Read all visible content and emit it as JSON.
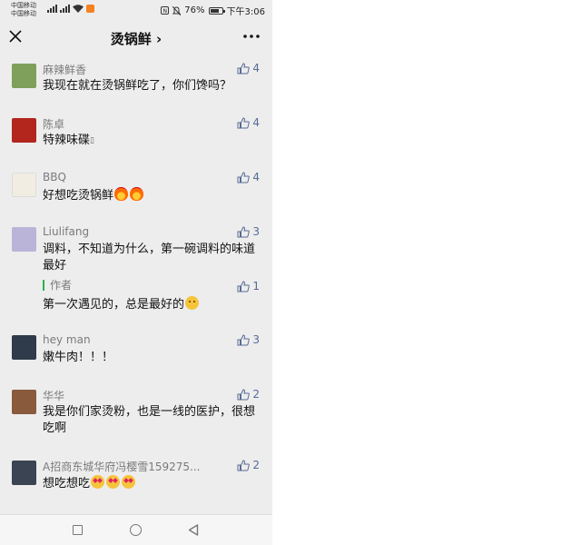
{
  "status_bar": {
    "carrier_1": "中国移动",
    "carrier_2": "中国移动",
    "battery_percent": "76%",
    "battery_level": 0.76,
    "time": "下午3:06"
  },
  "nav": {
    "title": "烫锅鲜 ›",
    "close_icon": "close-icon",
    "more_icon": "more-icon"
  },
  "comments": [
    {
      "name": "麻辣鲜香",
      "text": "我现在就在烫锅鲜吃了，你们馋吗？",
      "likes": "4",
      "avatar_color": "#7ea05a"
    },
    {
      "name": "陈卓",
      "text": "特辣味碟",
      "likes": "4",
      "avatar_color": "#b2261e"
    },
    {
      "name": "BBQ",
      "text": "好想吃烫锅鲜",
      "likes": "4",
      "avatar_color": "#f2ede3"
    },
    {
      "name": "Liulifang",
      "text": "调料，不知道为什么，第一碗调料的味道最好",
      "likes": "3",
      "avatar_color": "#b9b4d8",
      "reply": {
        "author_label": "作者",
        "text": "第一次遇见的，总是最好的",
        "likes": "1"
      }
    },
    {
      "name": "hey man",
      "text": "嫩牛肉！！！",
      "likes": "3",
      "avatar_color": "#2f3a4a"
    },
    {
      "name": "华华",
      "text": "我是你们家烫粉，也是一线的医护，很想吃啊",
      "likes": "2",
      "avatar_color": "#8a5a3c"
    },
    {
      "name": "A招商东城华府冯樱雪159275...",
      "text": "想吃想吃",
      "likes": "2",
      "avatar_color": "#3a4452"
    }
  ],
  "bottom_nav": {
    "square_icon": "recent-apps-icon",
    "circle_icon": "home-icon",
    "triangle_icon": "back-icon"
  }
}
